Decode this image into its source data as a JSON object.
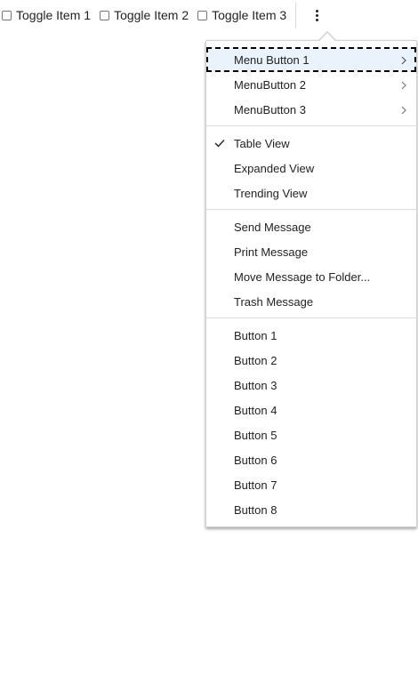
{
  "toolbar": {
    "toggles": [
      {
        "label": "Toggle Item 1",
        "checked": false
      },
      {
        "label": "Toggle Item 2",
        "checked": false
      },
      {
        "label": "Toggle Item 3",
        "checked": false
      }
    ],
    "overflow_icon": "kebab-vertical-icon"
  },
  "menu": {
    "submenus": [
      {
        "label": "Menu Button 1",
        "icon": "chevron-right-icon"
      },
      {
        "label": "MenuButton 2",
        "icon": "chevron-right-icon"
      },
      {
        "label": "MenuButton 3",
        "icon": "chevron-right-icon"
      }
    ],
    "views": [
      {
        "label": "Table View",
        "checked": true
      },
      {
        "label": "Expanded View",
        "checked": false
      },
      {
        "label": "Trending View",
        "checked": false
      }
    ],
    "actions": [
      {
        "label": "Send Message"
      },
      {
        "label": "Print Message"
      },
      {
        "label": "Move Message to Folder..."
      },
      {
        "label": "Trash Message"
      }
    ],
    "buttons": [
      {
        "label": "Button 1"
      },
      {
        "label": "Button 2"
      },
      {
        "label": "Button 3"
      },
      {
        "label": "Button 4"
      },
      {
        "label": "Button 5"
      },
      {
        "label": "Button 6"
      },
      {
        "label": "Button 7"
      },
      {
        "label": "Button 8"
      }
    ]
  },
  "colors": {
    "focus_background": "#eaf3fb",
    "separator": "#dcdcdc",
    "text": "#222222"
  }
}
